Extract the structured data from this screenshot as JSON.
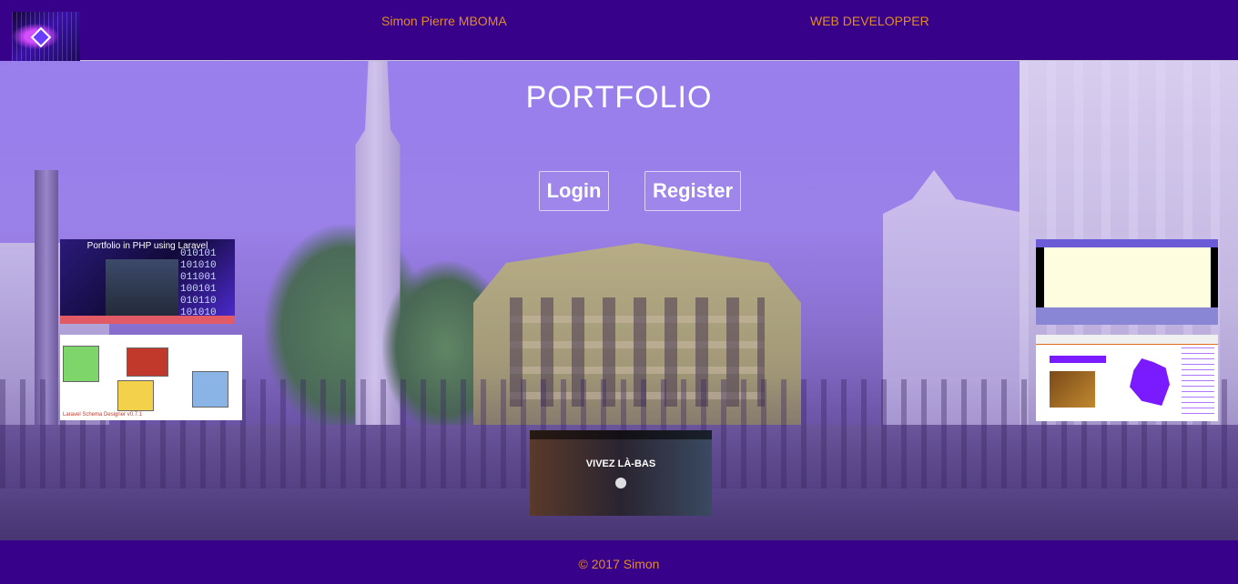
{
  "header": {
    "name": "Simon Pierre MBOMA",
    "role": "WEB DEVELOPPER",
    "logo_icon": "tunnel-logo-icon"
  },
  "main": {
    "title": "PORTFOLIO",
    "login_label": "Login",
    "register_label": "Register"
  },
  "thumbnails": {
    "laravel_portfolio": {
      "caption": "Portfolio in PHP using Laravel",
      "binary": "010101\n101010\n011001\n100101\n010110\n101010"
    },
    "schema_designer": {
      "caption": "Laravel Schema Designer v0.7.1"
    },
    "airbnb": {
      "caption": "VIVEZ LÀ-BAS"
    }
  },
  "footer": {
    "text": "© 2017 Simon"
  },
  "colors": {
    "bar": "#370189",
    "accent_text": "#e08b2a"
  }
}
